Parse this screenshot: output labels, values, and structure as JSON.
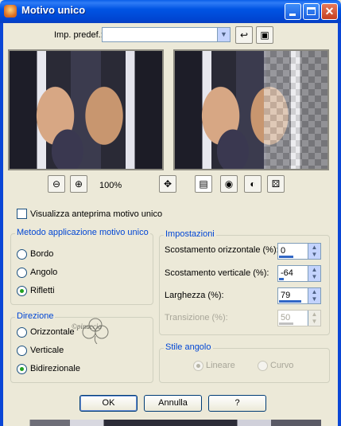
{
  "window": {
    "title": "Motivo unico"
  },
  "preset": {
    "label": "Imp. predef.:",
    "value": ""
  },
  "zoom": {
    "level": "100%"
  },
  "preview_checkbox": {
    "label": "Visualizza anteprima motivo unico",
    "checked": false
  },
  "metodo": {
    "legend": "Metodo applicazione motivo unico",
    "options": [
      {
        "label": "Bordo",
        "selected": false
      },
      {
        "label": "Angolo",
        "selected": false
      },
      {
        "label": "Rifletti",
        "selected": true
      }
    ]
  },
  "direzione": {
    "legend": "Direzione",
    "watermark": "©pinuccia",
    "options": [
      {
        "label": "Orizzontale",
        "selected": false
      },
      {
        "label": "Verticale",
        "selected": false
      },
      {
        "label": "Bidirezionale",
        "selected": true
      }
    ]
  },
  "impostazioni": {
    "legend": "Impostazioni",
    "fields": [
      {
        "label": "Scostamento orizzontale (%):",
        "value": "0",
        "fill": 0.5,
        "enabled": true
      },
      {
        "label": "Scostamento verticale (%):",
        "value": "-64",
        "fill": 0.18,
        "enabled": true
      },
      {
        "label": "Larghezza (%):",
        "value": "79",
        "fill": 0.79,
        "enabled": true
      },
      {
        "label": "Transizione (%):",
        "value": "50",
        "fill": 0.5,
        "enabled": false
      }
    ]
  },
  "stile_angolo": {
    "legend": "Stile angolo",
    "options": [
      {
        "label": "Lineare",
        "selected": true
      },
      {
        "label": "Curvo",
        "selected": false
      }
    ]
  },
  "buttons": {
    "ok": "OK",
    "cancel": "Annulla",
    "help": "?"
  },
  "colors": {
    "titlebar": "#0054e3",
    "dialog_bg": "#ece9d8",
    "legend_text": "#0046d5",
    "radio_dot": "#21a121"
  }
}
